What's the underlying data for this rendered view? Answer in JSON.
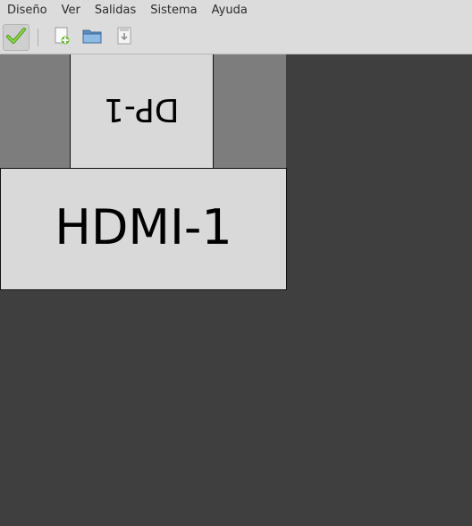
{
  "menubar": {
    "items": [
      "Diseño",
      "Ver",
      "Salidas",
      "Sistema",
      "Ayuda"
    ]
  },
  "toolbar": {
    "buttons": [
      {
        "icon": "apply-check-icon",
        "state": "pressed"
      },
      {
        "icon": "new-layout-icon"
      },
      {
        "icon": "open-folder-icon"
      },
      {
        "icon": "save-layout-icon"
      }
    ]
  },
  "outputs": [
    {
      "name": "DP-1",
      "rotation": "inverted"
    },
    {
      "name": "HDMI-1",
      "rotation": "normal"
    }
  ],
  "colors": {
    "chrome": "#dcdcdc",
    "canvas": "#3f3f3f",
    "virtual_screen": "#7d7d7d",
    "output_fill": "#d9d9d9",
    "apply_green": "#6bbf2f"
  }
}
